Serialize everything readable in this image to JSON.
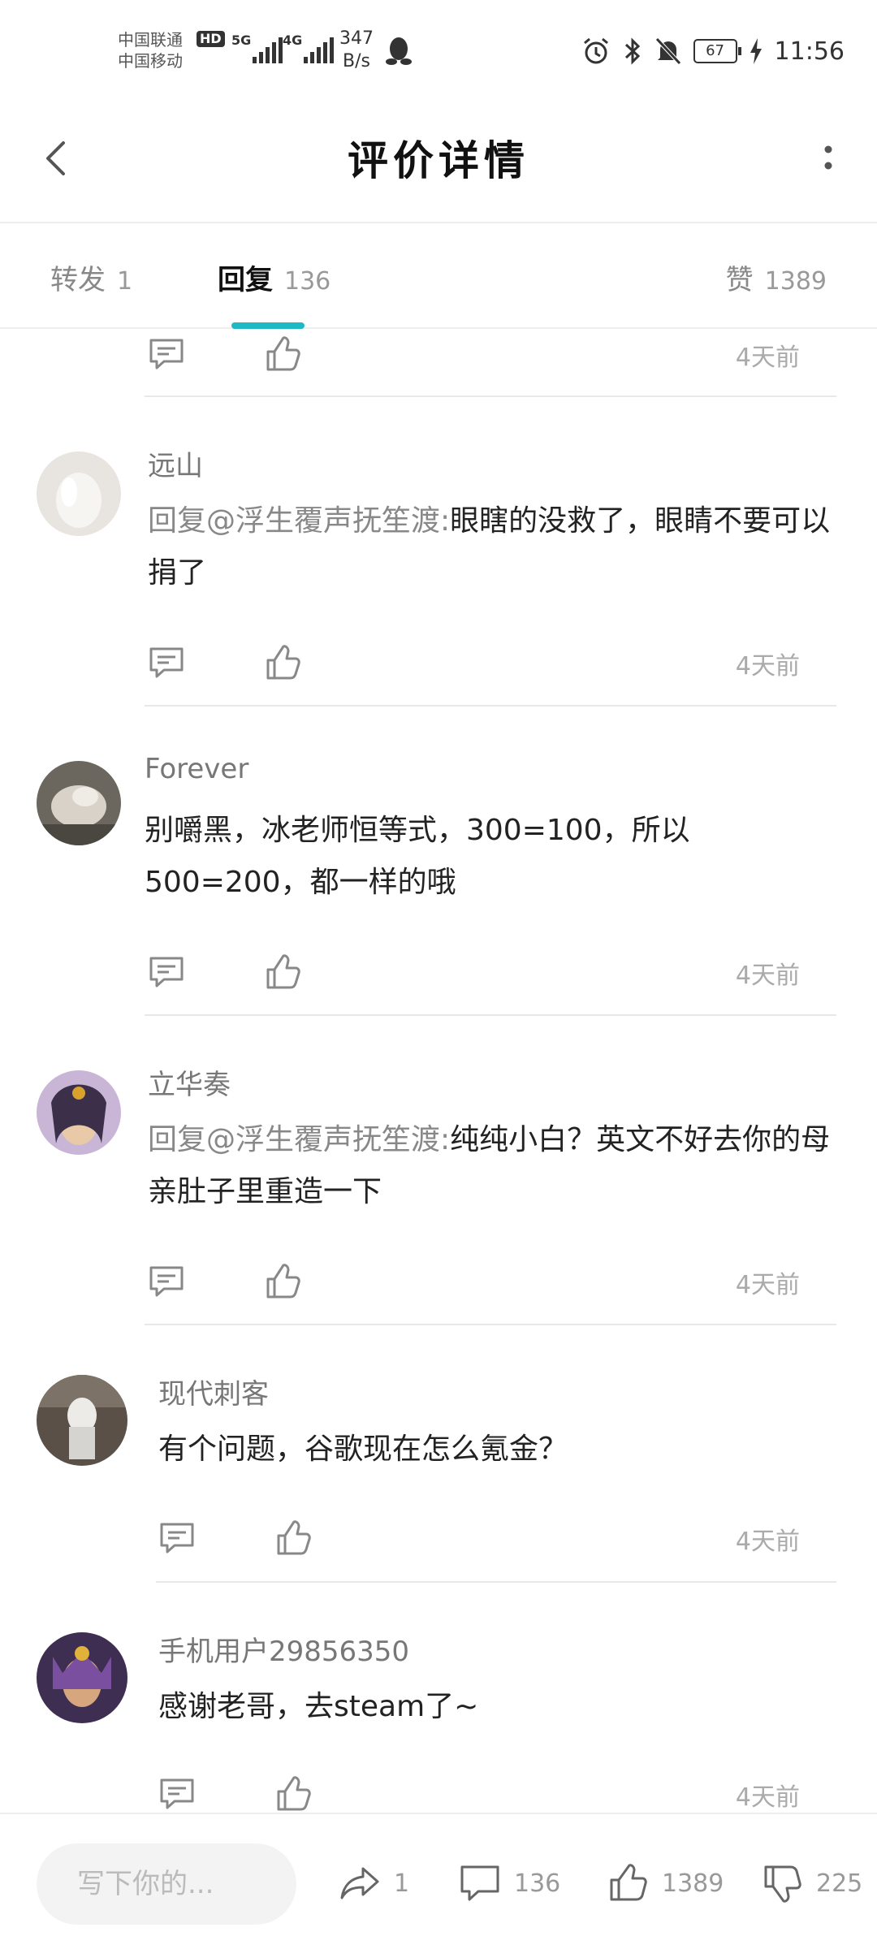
{
  "status_bar": {
    "carrier_1": "中国联通",
    "carrier_2": "中国移动",
    "hd": "HD",
    "net_5g": "5G",
    "net_4g": "4G",
    "speed_value": "347",
    "speed_unit": "B/s",
    "battery": "67",
    "time": "11:56",
    "icons": [
      "qq-icon",
      "alarm-icon",
      "bluetooth-icon",
      "mute-icon",
      "battery-icon",
      "charging-icon"
    ]
  },
  "header": {
    "title": "评价详情"
  },
  "tabs": [
    {
      "label": "转发",
      "count": "1"
    },
    {
      "label": "回复",
      "count": "136"
    },
    {
      "label": "赞",
      "count": "1389"
    }
  ],
  "top_partial": {
    "time": "4天前"
  },
  "comments": [
    {
      "name": "远山",
      "mention": "回复@浮生覆声抚笙渡:",
      "body": "眼瞎的没救了，眼睛不要可以捐了",
      "time": "4天前"
    },
    {
      "name": "Forever",
      "mention": "",
      "body": "别嚼黑，冰老师恒等式，300=100，所以500=200，都一样的哦",
      "time": "4天前"
    },
    {
      "name": "立华奏",
      "mention": "回复@浮生覆声抚笙渡:",
      "body": "纯纯小白？英文不好去你的母亲肚子里重造一下",
      "time": "4天前"
    },
    {
      "name": "现代刺客",
      "mention": "",
      "body": "有个问题，谷歌现在怎么氪金？",
      "time": "4天前"
    },
    {
      "name": "手机用户29856350",
      "mention": "",
      "body": "感谢老哥，去steam了~",
      "time": "4天前"
    }
  ],
  "bottom_bar": {
    "placeholder": "写下你的...",
    "share_count": "1",
    "comment_count": "136",
    "like_count": "1389",
    "dislike_count": "225"
  },
  "colors": {
    "accent": "#1fb8c5"
  }
}
